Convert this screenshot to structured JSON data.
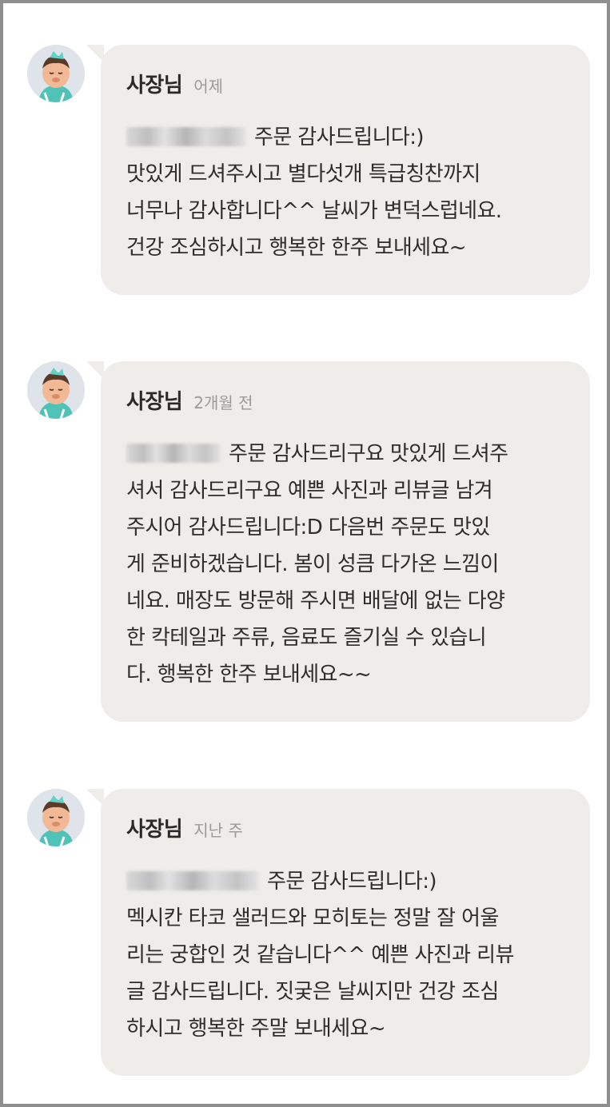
{
  "replies": [
    {
      "author": "사장님",
      "time": "어제",
      "intro": "주문 감사드립니다:)",
      "lines": [
        "맛있게 드셔주시고 별다섯개 특급칭찬까지",
        "너무나 감사합니다^^ 날씨가 변덕스럽네요.",
        "건강 조심하시고 행복한 한주 보내세요~"
      ],
      "avatar_icon": "owner-avatar-icon"
    },
    {
      "author": "사장님",
      "time": "2개월 전",
      "intro": "주문 감사드리구요 맛있게 드셔주",
      "lines": [
        "셔서 감사드리구요 예쁜 사진과 리뷰글 남겨",
        "주시어 감사드립니다:D 다음번 주문도 맛있",
        "게 준비하겠습니다. 봄이 성큼 다가온 느낌이",
        "네요. 매장도 방문해 주시면 배달에 없는 다양",
        "한 칵테일과 주류, 음료도 즐기실 수 있습니",
        "다. 행복한 한주 보내세요~~"
      ],
      "avatar_icon": "owner-avatar-icon"
    },
    {
      "author": "사장님",
      "time": "지난 주",
      "intro": "주문 감사드립니다:)",
      "lines": [
        "멕시칸 타코 샐러드와 모히토는 정말 잘 어울",
        "리는 궁합인 것 같습니다^^ 예쁜 사진과 리뷰",
        "글 감사드립니다. 짓궂은 날씨지만 건강 조심",
        "하시고 행복한 주말 보내세요~"
      ],
      "avatar_icon": "owner-avatar-icon"
    }
  ],
  "colors": {
    "bubble": "#efede9",
    "frame_border": "#8e8e8e",
    "text": "#2d2d2d",
    "time": "#9a9a9a"
  }
}
